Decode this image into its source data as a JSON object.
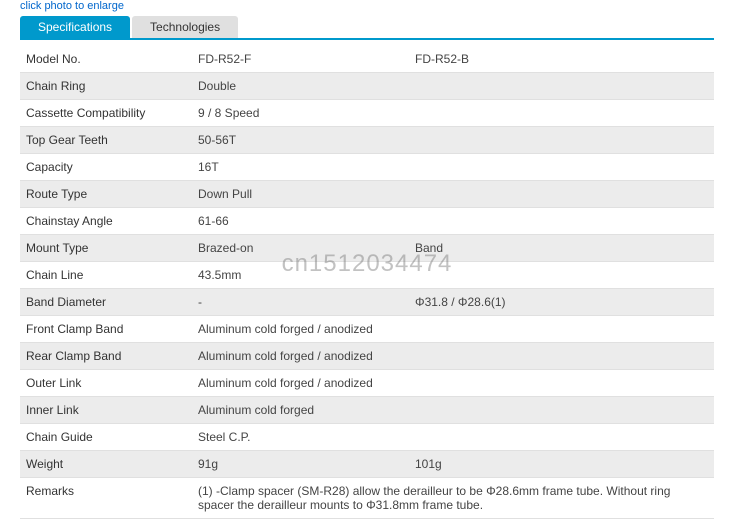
{
  "topLink": "click photo to enlarge",
  "tabs": {
    "active": "Specifications",
    "inactive": "Technologies"
  },
  "watermark": "cn1512034474",
  "rows": [
    {
      "label": "Model No.",
      "v1": "FD-R52-F",
      "v2": "FD-R52-B",
      "span": false
    },
    {
      "label": "Chain Ring",
      "v1": "Double",
      "v2": "",
      "span": true
    },
    {
      "label": "Cassette Compatibility",
      "v1": "9 / 8 Speed",
      "v2": "",
      "span": true
    },
    {
      "label": "Top Gear Teeth",
      "v1": "50-56T",
      "v2": "",
      "span": true
    },
    {
      "label": "Capacity",
      "v1": "16T",
      "v2": "",
      "span": true
    },
    {
      "label": "Route Type",
      "v1": "Down Pull",
      "v2": "",
      "span": true
    },
    {
      "label": "Chainstay Angle",
      "v1": "61-66",
      "v2": "",
      "span": true
    },
    {
      "label": "Mount Type",
      "v1": "Brazed-on",
      "v2": "Band",
      "span": false
    },
    {
      "label": "Chain Line",
      "v1": "43.5mm",
      "v2": "",
      "span": true
    },
    {
      "label": "Band Diameter",
      "v1": "-",
      "v2": "Φ31.8 / Φ28.6(1)",
      "span": false
    },
    {
      "label": "Front Clamp Band",
      "v1": "Aluminum cold forged / anodized",
      "v2": "",
      "span": true
    },
    {
      "label": "Rear Clamp Band",
      "v1": "Aluminum cold forged / anodized",
      "v2": "",
      "span": true
    },
    {
      "label": "Outer Link",
      "v1": "Aluminum cold forged / anodized",
      "v2": "",
      "span": true
    },
    {
      "label": "Inner Link",
      "v1": "Aluminum cold forged",
      "v2": "",
      "span": true
    },
    {
      "label": "Chain Guide",
      "v1": "Steel C.P.",
      "v2": "",
      "span": true
    },
    {
      "label": "Weight",
      "v1": "91g",
      "v2": "101g",
      "span": false
    },
    {
      "label": "Remarks",
      "v1": "(1) -Clamp spacer (SM-R28) allow the derailleur to be Φ28.6mm frame tube. Without ring spacer the derailleur mounts to Φ31.8mm frame tube.",
      "v2": "",
      "span": true
    }
  ]
}
